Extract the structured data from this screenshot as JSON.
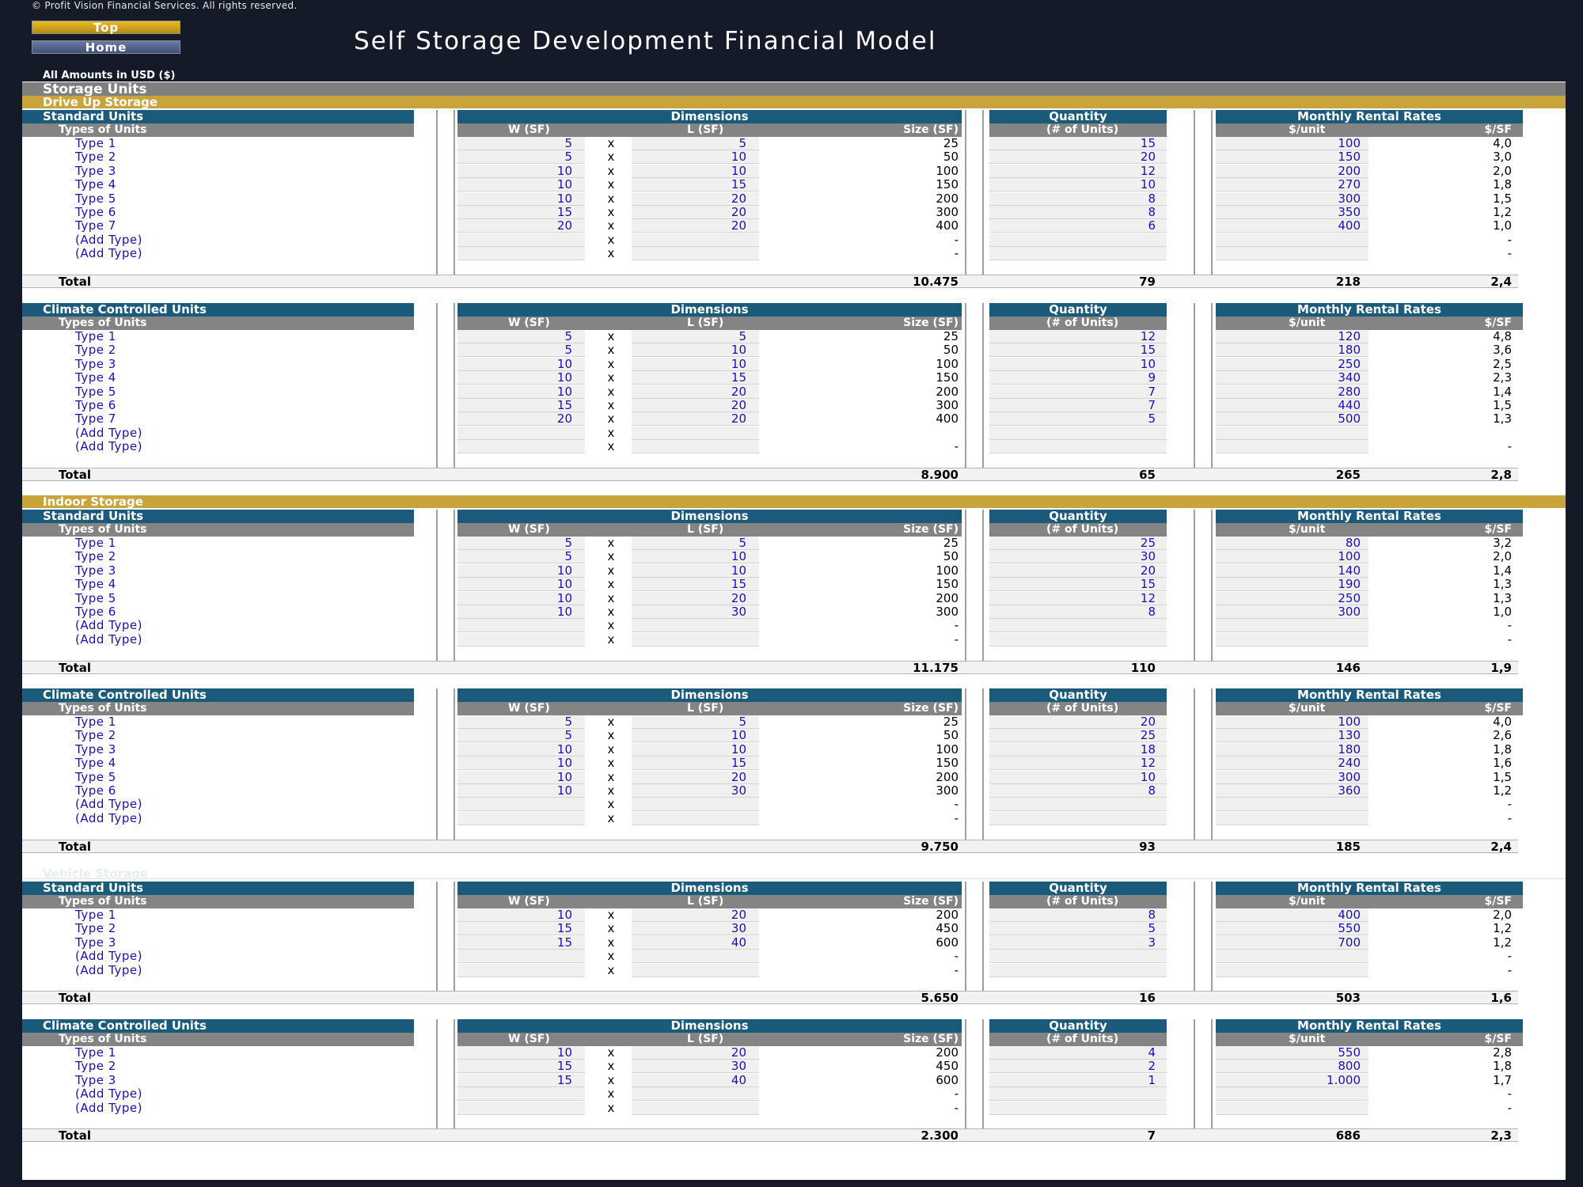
{
  "copyright": "© Profit Vision Financial Services. All rights reserved.",
  "nav": {
    "top_label": "Top",
    "home_label": "Home"
  },
  "title": "Self Storage Development Financial Model",
  "amounts_note": "All Amounts in  USD ($)",
  "section_title": "Storage Units",
  "headers": {
    "dimensions": "Dimensions",
    "quantity": "Quantity",
    "rates": "Monthly Rental Rates",
    "types": "Types of Units",
    "w": "W (SF)",
    "l": "L (SF)",
    "size": "Size (SF)",
    "units": "(# of Units)",
    "per_unit": "$/unit",
    "per_sf": "$/SF",
    "x": "x",
    "total": "Total"
  },
  "categories": [
    {
      "name": "Drive Up Storage",
      "faint": false,
      "groups": [
        {
          "name": "Standard Units",
          "rows": [
            {
              "type": "Type 1",
              "w": "5",
              "l": "5",
              "size": "25",
              "qty": "15",
              "rate": "100",
              "psf": "4,0"
            },
            {
              "type": "Type 2",
              "w": "5",
              "l": "10",
              "size": "50",
              "qty": "20",
              "rate": "150",
              "psf": "3,0"
            },
            {
              "type": "Type 3",
              "w": "10",
              "l": "10",
              "size": "100",
              "qty": "12",
              "rate": "200",
              "psf": "2,0"
            },
            {
              "type": "Type 4",
              "w": "10",
              "l": "15",
              "size": "150",
              "qty": "10",
              "rate": "270",
              "psf": "1,8"
            },
            {
              "type": "Type 5",
              "w": "10",
              "l": "20",
              "size": "200",
              "qty": "8",
              "rate": "300",
              "psf": "1,5"
            },
            {
              "type": "Type 6",
              "w": "15",
              "l": "20",
              "size": "300",
              "qty": "8",
              "rate": "350",
              "psf": "1,2"
            },
            {
              "type": "Type 7",
              "w": "20",
              "l": "20",
              "size": "400",
              "qty": "6",
              "rate": "400",
              "psf": "1,0"
            },
            {
              "type": "(Add Type)",
              "w": "",
              "l": "",
              "size": "-",
              "qty": "",
              "rate": "",
              "psf": "-"
            },
            {
              "type": "(Add Type)",
              "w": "",
              "l": "",
              "size": "-",
              "qty": "",
              "rate": "",
              "psf": "-"
            }
          ],
          "total": {
            "size": "10.475",
            "qty": "79",
            "rate": "218",
            "psf": "2,4"
          }
        },
        {
          "name": "Climate Controlled Units",
          "rows": [
            {
              "type": "Type 1",
              "w": "5",
              "l": "5",
              "size": "25",
              "qty": "12",
              "rate": "120",
              "psf": "4,8"
            },
            {
              "type": "Type 2",
              "w": "5",
              "l": "10",
              "size": "50",
              "qty": "15",
              "rate": "180",
              "psf": "3,6"
            },
            {
              "type": "Type 3",
              "w": "10",
              "l": "10",
              "size": "100",
              "qty": "10",
              "rate": "250",
              "psf": "2,5"
            },
            {
              "type": "Type 4",
              "w": "10",
              "l": "15",
              "size": "150",
              "qty": "9",
              "rate": "340",
              "psf": "2,3"
            },
            {
              "type": "Type 5",
              "w": "10",
              "l": "20",
              "size": "200",
              "qty": "7",
              "rate": "280",
              "psf": "1,4"
            },
            {
              "type": "Type 6",
              "w": "15",
              "l": "20",
              "size": "300",
              "qty": "7",
              "rate": "440",
              "psf": "1,5"
            },
            {
              "type": "Type 7",
              "w": "20",
              "l": "20",
              "size": "400",
              "qty": "5",
              "rate": "500",
              "psf": "1,3"
            },
            {
              "type": "(Add Type)",
              "w": "",
              "l": "",
              "size": "",
              "qty": "",
              "rate": "",
              "psf": ""
            },
            {
              "type": "(Add Type)",
              "w": "",
              "l": "",
              "size": "-",
              "qty": "",
              "rate": "",
              "psf": "-"
            }
          ],
          "total": {
            "size": "8.900",
            "qty": "65",
            "rate": "265",
            "psf": "2,8"
          }
        }
      ]
    },
    {
      "name": "Indoor Storage",
      "faint": false,
      "groups": [
        {
          "name": "Standard Units",
          "rows": [
            {
              "type": "Type 1",
              "w": "5",
              "l": "5",
              "size": "25",
              "qty": "25",
              "rate": "80",
              "psf": "3,2"
            },
            {
              "type": "Type 2",
              "w": "5",
              "l": "10",
              "size": "50",
              "qty": "30",
              "rate": "100",
              "psf": "2,0"
            },
            {
              "type": "Type 3",
              "w": "10",
              "l": "10",
              "size": "100",
              "qty": "20",
              "rate": "140",
              "psf": "1,4"
            },
            {
              "type": "Type 4",
              "w": "10",
              "l": "15",
              "size": "150",
              "qty": "15",
              "rate": "190",
              "psf": "1,3"
            },
            {
              "type": "Type 5",
              "w": "10",
              "l": "20",
              "size": "200",
              "qty": "12",
              "rate": "250",
              "psf": "1,3"
            },
            {
              "type": "Type 6",
              "w": "10",
              "l": "30",
              "size": "300",
              "qty": "8",
              "rate": "300",
              "psf": "1,0"
            },
            {
              "type": "(Add Type)",
              "w": "",
              "l": "",
              "size": "-",
              "qty": "",
              "rate": "",
              "psf": "-"
            },
            {
              "type": "(Add Type)",
              "w": "",
              "l": "",
              "size": "-",
              "qty": "",
              "rate": "",
              "psf": "-"
            }
          ],
          "total": {
            "size": "11.175",
            "qty": "110",
            "rate": "146",
            "psf": "1,9"
          }
        },
        {
          "name": "Climate Controlled Units",
          "rows": [
            {
              "type": "Type 1",
              "w": "5",
              "l": "5",
              "size": "25",
              "qty": "20",
              "rate": "100",
              "psf": "4,0"
            },
            {
              "type": "Type 2",
              "w": "5",
              "l": "10",
              "size": "50",
              "qty": "25",
              "rate": "130",
              "psf": "2,6"
            },
            {
              "type": "Type 3",
              "w": "10",
              "l": "10",
              "size": "100",
              "qty": "18",
              "rate": "180",
              "psf": "1,8"
            },
            {
              "type": "Type 4",
              "w": "10",
              "l": "15",
              "size": "150",
              "qty": "12",
              "rate": "240",
              "psf": "1,6"
            },
            {
              "type": "Type 5",
              "w": "10",
              "l": "20",
              "size": "200",
              "qty": "10",
              "rate": "300",
              "psf": "1,5"
            },
            {
              "type": "Type 6",
              "w": "10",
              "l": "30",
              "size": "300",
              "qty": "8",
              "rate": "360",
              "psf": "1,2"
            },
            {
              "type": "(Add Type)",
              "w": "",
              "l": "",
              "size": "-",
              "qty": "",
              "rate": "",
              "psf": "-"
            },
            {
              "type": "(Add Type)",
              "w": "",
              "l": "",
              "size": "-",
              "qty": "",
              "rate": "",
              "psf": "-"
            }
          ],
          "total": {
            "size": "9.750",
            "qty": "93",
            "rate": "185",
            "psf": "2,4"
          }
        }
      ]
    },
    {
      "name": "Vehicle Storage",
      "faint": true,
      "groups": [
        {
          "name": "Standard Units",
          "rows": [
            {
              "type": "Type 1",
              "w": "10",
              "l": "20",
              "size": "200",
              "qty": "8",
              "rate": "400",
              "psf": "2,0"
            },
            {
              "type": "Type 2",
              "w": "15",
              "l": "30",
              "size": "450",
              "qty": "5",
              "rate": "550",
              "psf": "1,2"
            },
            {
              "type": "Type 3",
              "w": "15",
              "l": "40",
              "size": "600",
              "qty": "3",
              "rate": "700",
              "psf": "1,2"
            },
            {
              "type": "(Add Type)",
              "w": "",
              "l": "",
              "size": "-",
              "qty": "",
              "rate": "",
              "psf": "-"
            },
            {
              "type": "(Add Type)",
              "w": "",
              "l": "",
              "size": "-",
              "qty": "",
              "rate": "",
              "psf": "-"
            }
          ],
          "total": {
            "size": "5.650",
            "qty": "16",
            "rate": "503",
            "psf": "1,6"
          }
        },
        {
          "name": "Climate Controlled Units",
          "rows": [
            {
              "type": "Type 1",
              "w": "10",
              "l": "20",
              "size": "200",
              "qty": "4",
              "rate": "550",
              "psf": "2,8"
            },
            {
              "type": "Type 2",
              "w": "15",
              "l": "30",
              "size": "450",
              "qty": "2",
              "rate": "800",
              "psf": "1,8"
            },
            {
              "type": "Type 3",
              "w": "15",
              "l": "40",
              "size": "600",
              "qty": "1",
              "rate": "1.000",
              "psf": "1,7"
            },
            {
              "type": "(Add Type)",
              "w": "",
              "l": "",
              "size": "-",
              "qty": "",
              "rate": "",
              "psf": "-"
            },
            {
              "type": "(Add Type)",
              "w": "",
              "l": "",
              "size": "-",
              "qty": "",
              "rate": "",
              "psf": "-"
            }
          ],
          "total": {
            "size": "2.300",
            "qty": "7",
            "rate": "686",
            "psf": "2,3"
          }
        }
      ]
    }
  ]
}
